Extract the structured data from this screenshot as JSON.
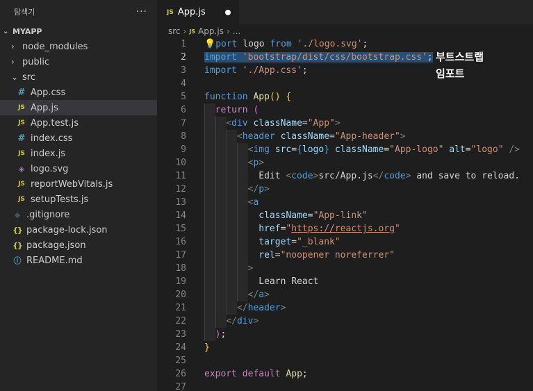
{
  "sidebar": {
    "title": "탐색기",
    "more": "···",
    "project": "MYAPP",
    "items": [
      {
        "label": "node_modules",
        "kind": "folder",
        "chev": "›",
        "depth": 1
      },
      {
        "label": "public",
        "kind": "folder",
        "chev": "›",
        "depth": 1
      },
      {
        "label": "src",
        "kind": "folder-open",
        "chev": "⌄",
        "depth": 1
      },
      {
        "label": "App.css",
        "kind": "css",
        "icon": "#",
        "depth": 2
      },
      {
        "label": "App.js",
        "kind": "js",
        "icon": "JS",
        "depth": 2,
        "active": true
      },
      {
        "label": "App.test.js",
        "kind": "js",
        "icon": "JS",
        "depth": 2
      },
      {
        "label": "index.css",
        "kind": "css",
        "icon": "#",
        "depth": 2
      },
      {
        "label": "index.js",
        "kind": "js",
        "icon": "JS",
        "depth": 2
      },
      {
        "label": "logo.svg",
        "kind": "svg",
        "icon": "◈",
        "depth": 2
      },
      {
        "label": "reportWebVitals.js",
        "kind": "js",
        "icon": "JS",
        "depth": 2
      },
      {
        "label": "setupTests.js",
        "kind": "js",
        "icon": "JS",
        "depth": 2
      },
      {
        "label": ".gitignore",
        "kind": "git",
        "icon": "◆",
        "depth": 1
      },
      {
        "label": "package-lock.json",
        "kind": "json",
        "icon": "{}",
        "depth": 1
      },
      {
        "label": "package.json",
        "kind": "json",
        "icon": "{}",
        "depth": 1
      },
      {
        "label": "README.md",
        "kind": "info",
        "icon": "ⓘ",
        "depth": 1
      }
    ]
  },
  "tab": {
    "icon": "JS",
    "label": "App.js"
  },
  "breadcrumb": {
    "folder": "src",
    "icon": "JS",
    "file": "App.js",
    "more": "..."
  },
  "annotation": [
    "부트스트랩",
    "임포트"
  ],
  "colors": {
    "keyword": "#569cd6",
    "control": "#c586c0",
    "string": "#ce9178",
    "function": "#dcdcaa",
    "attribute": "#9cdcfe",
    "selection": "#264f78",
    "js_icon": "#cbcb41",
    "css_icon": "#519aba"
  },
  "code_lines": [
    [
      [
        "bulb",
        "💡"
      ],
      [
        "k",
        "port "
      ],
      [
        "",
        "logo "
      ],
      [
        "k",
        "from "
      ],
      [
        "s",
        "'./logo.svg'"
      ],
      [
        "",
        ";"
      ]
    ],
    [
      [
        "k sel",
        "import"
      ],
      [
        "sel",
        " "
      ],
      [
        "s sel",
        "'bootstrap/dist/css/bootstrap.css'"
      ],
      [
        "sel",
        ";"
      ]
    ],
    [
      [
        "k",
        "import "
      ],
      [
        "s",
        "'./App.css'"
      ],
      [
        "",
        ";"
      ]
    ],
    [],
    [
      [
        "k",
        "function "
      ],
      [
        "f",
        "App"
      ],
      [
        "b1",
        "()"
      ],
      [
        "",
        ""
      ],
      [
        "b1",
        " {"
      ]
    ],
    [
      [
        "",
        "  "
      ],
      [
        "kc",
        "return "
      ],
      [
        "b2",
        "("
      ]
    ],
    [
      [
        "",
        "    "
      ],
      [
        "p",
        "<"
      ],
      [
        "t",
        "div "
      ],
      [
        "a",
        "className"
      ],
      [
        "",
        "="
      ],
      [
        "s",
        "\"App\""
      ],
      [
        "p",
        ">"
      ]
    ],
    [
      [
        "",
        "      "
      ],
      [
        "p",
        "<"
      ],
      [
        "t",
        "header "
      ],
      [
        "a",
        "className"
      ],
      [
        "",
        "="
      ],
      [
        "s",
        "\"App-header\""
      ],
      [
        "p",
        ">"
      ]
    ],
    [
      [
        "",
        "        "
      ],
      [
        "p",
        "<"
      ],
      [
        "t",
        "img "
      ],
      [
        "a",
        "src"
      ],
      [
        "",
        "="
      ],
      [
        "k",
        "{"
      ],
      [
        "a",
        "logo"
      ],
      [
        "k",
        "} "
      ],
      [
        "a",
        "className"
      ],
      [
        "",
        "="
      ],
      [
        "s",
        "\"App-logo\" "
      ],
      [
        "a",
        "alt"
      ],
      [
        "",
        "="
      ],
      [
        "s",
        "\"logo\" "
      ],
      [
        "p",
        "/>"
      ]
    ],
    [
      [
        "",
        "        "
      ],
      [
        "p",
        "<"
      ],
      [
        "t",
        "p"
      ],
      [
        "p",
        ">"
      ]
    ],
    [
      [
        "",
        "          Edit "
      ],
      [
        "p",
        "<"
      ],
      [
        "t",
        "code"
      ],
      [
        "p",
        ">"
      ],
      [
        "",
        "src/App.js"
      ],
      [
        "p",
        "</"
      ],
      [
        "t",
        "code"
      ],
      [
        "p",
        "> "
      ],
      [
        "",
        "and save to reload."
      ]
    ],
    [
      [
        "",
        "        "
      ],
      [
        "p",
        "</"
      ],
      [
        "t",
        "p"
      ],
      [
        "p",
        ">"
      ]
    ],
    [
      [
        "",
        "        "
      ],
      [
        "p",
        "<"
      ],
      [
        "t",
        "a"
      ]
    ],
    [
      [
        "",
        "          "
      ],
      [
        "a",
        "className"
      ],
      [
        "",
        "="
      ],
      [
        "s",
        "\"App-link\""
      ]
    ],
    [
      [
        "",
        "          "
      ],
      [
        "a",
        "href"
      ],
      [
        "",
        "="
      ],
      [
        "s",
        "\""
      ],
      [
        "s lnk",
        "https://reactjs.org"
      ],
      [
        "s",
        "\""
      ]
    ],
    [
      [
        "",
        "          "
      ],
      [
        "a",
        "target"
      ],
      [
        "",
        "="
      ],
      [
        "s",
        "\"_blank\""
      ]
    ],
    [
      [
        "",
        "          "
      ],
      [
        "a",
        "rel"
      ],
      [
        "",
        "="
      ],
      [
        "s",
        "\"noopener noreferrer\""
      ]
    ],
    [
      [
        "",
        "        "
      ],
      [
        "p",
        ">"
      ]
    ],
    [
      [
        "",
        "          Learn React"
      ]
    ],
    [
      [
        "",
        "        "
      ],
      [
        "p",
        "</"
      ],
      [
        "t",
        "a"
      ],
      [
        "p",
        ">"
      ]
    ],
    [
      [
        "",
        "      "
      ],
      [
        "p",
        "</"
      ],
      [
        "t",
        "header"
      ],
      [
        "p",
        ">"
      ]
    ],
    [
      [
        "",
        "    "
      ],
      [
        "p",
        "</"
      ],
      [
        "t",
        "div"
      ],
      [
        "p",
        ">"
      ]
    ],
    [
      [
        "",
        "  "
      ],
      [
        "b2",
        ")"
      ],
      [
        "",
        ";"
      ]
    ],
    [
      [
        "b1",
        "}"
      ]
    ],
    [],
    [
      [
        "kc",
        "export "
      ],
      [
        "kc",
        "default "
      ],
      [
        "f",
        "App"
      ],
      [
        "",
        ";"
      ]
    ],
    []
  ],
  "line_numbers": [
    "1",
    "2",
    "3",
    "4",
    "5",
    "6",
    "7",
    "8",
    "9",
    "10",
    "11",
    "12",
    "13",
    "14",
    "15",
    "16",
    "17",
    "18",
    "19",
    "20",
    "21",
    "22",
    "23",
    "24",
    "25",
    "26",
    "27"
  ],
  "current_line": 2
}
